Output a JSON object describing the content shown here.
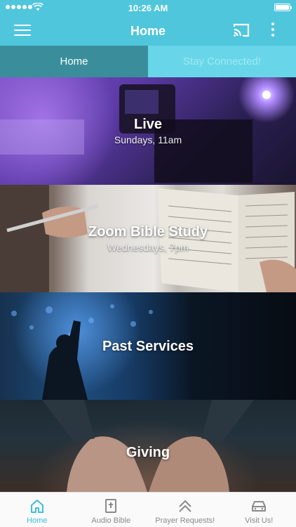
{
  "status_bar": {
    "time": "10:26 AM"
  },
  "header": {
    "title": "Home",
    "menu_icon": "hamburger-menu-icon",
    "cast_icon": "cast-icon",
    "more_icon": "more-vertical-icon",
    "color": "#4fc6dc"
  },
  "tabs": [
    {
      "label": "Home",
      "active": true
    },
    {
      "label": "Stay Connected!",
      "active": false
    }
  ],
  "tiles": [
    {
      "title": "Live",
      "subtitle": "Sundays, 11am"
    },
    {
      "title": "Zoom Bible Study",
      "subtitle": "Wednesdays, 7pm"
    },
    {
      "title": "Past Services"
    },
    {
      "title": "Giving"
    }
  ],
  "bottom_nav": [
    {
      "label": "Home",
      "icon": "home-icon",
      "active": true
    },
    {
      "label": "Audio Bible",
      "icon": "bible-icon",
      "active": false
    },
    {
      "label": "Prayer Requests!",
      "icon": "double-chevron-up-icon",
      "active": false
    },
    {
      "label": "Visit Us!",
      "icon": "car-icon",
      "active": false
    }
  ],
  "colors": {
    "accent": "#3cc0dc",
    "active_tab": "#3a8e9b",
    "inactive_tab": "#68d6e8"
  }
}
